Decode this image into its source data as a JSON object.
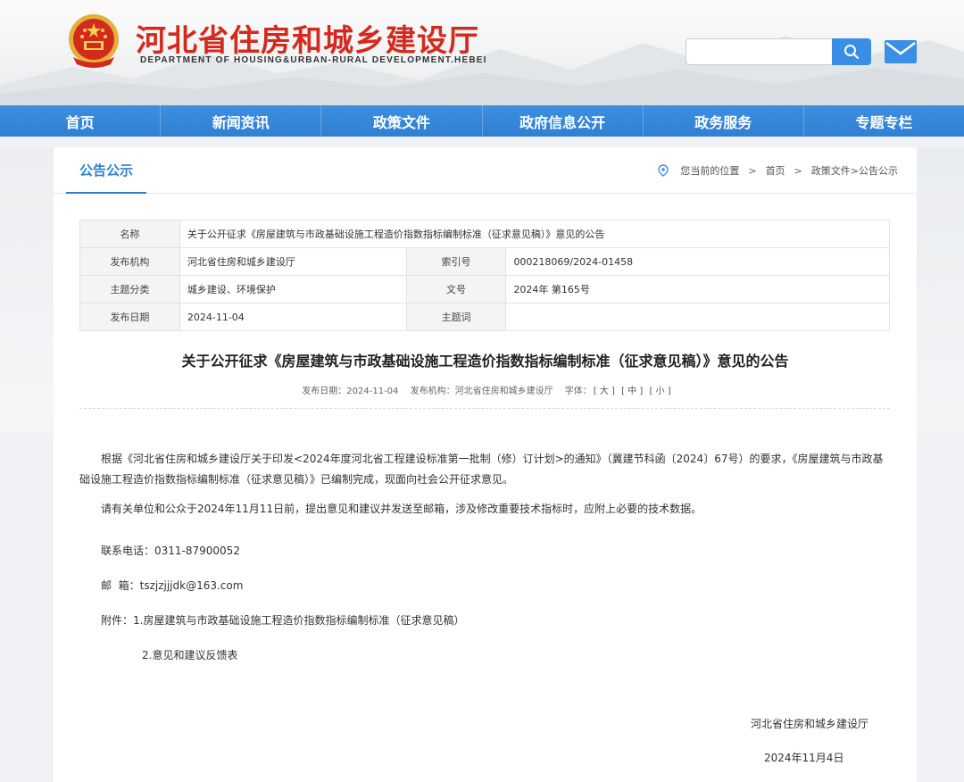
{
  "header": {
    "title": "河北省住房和城乡建设厅",
    "subtitle": "DEPARTMENT OF HOUSING&URBAN-RURAL DEVELOPMENT.HEBEI",
    "search_placeholder": ""
  },
  "nav": {
    "items": [
      "首页",
      "新闻资讯",
      "政策文件",
      "政府信息公开",
      "政务服务",
      "专题专栏"
    ]
  },
  "section": {
    "tab": "公告公示",
    "breadcrumb": {
      "prefix": "您当前的位置",
      "home": "首页",
      "path": "政策文件>公告公示"
    }
  },
  "info": {
    "name_label": "名称",
    "name_value": "关于公开征求《房屋建筑与市政基础设施工程造价指数指标编制标准（征求意见稿）》意见的公告",
    "org_label": "发布机构",
    "org_value": "河北省住房和城乡建设厅",
    "index_label": "索引号",
    "index_value": "000218069/2024-01458",
    "topic_label": "主题分类",
    "topic_value": "城乡建设、环境保护",
    "docno_label": "文号",
    "docno_value": "2024年 第165号",
    "date_label": "发布日期",
    "date_value": "2024-11-04",
    "keyword_label": "主题词",
    "keyword_value": ""
  },
  "article": {
    "title": "关于公开征求《房屋建筑与市政基础设施工程造价指数指标编制标准（征求意见稿）》意见的公告",
    "meta_date": "发布日期：2024-11-04",
    "meta_org": "发布机构：河北省住房和城乡建设厅",
    "meta_font": "字体：",
    "font_large": "[ 大 ]",
    "font_medium": "[ 中 ]",
    "font_small": "[ 小 ]",
    "p1": "根据《河北省住房和城乡建设厅关于印发<2024年度河北省工程建设标准第一批制（修）订计划>的通知》（冀建节科函〔2024〕67号）的要求，《房屋建筑与市政基础设施工程造价指数指标编制标准（征求意见稿）》已编制完成，现面向社会公开征求意见。",
    "p2": "请有关单位和公众于2024年11月11日前，提出意见和建议并发送至邮箱，涉及修改重要技术指标时，应附上必要的技术数据。",
    "phone": "联系电话：0311-87900052",
    "email": "邮  箱：tszjzjjjdk@163.com",
    "attachment1": "附件：1.房屋建筑与市政基础设施工程造价指数指标编制标准（征求意见稿）",
    "attachment2": "2.意见和建议反馈表",
    "sign_org": "河北省住房和城乡建设厅",
    "sign_date": "2024年11月4日"
  },
  "colors": {
    "brand_red": "#d42a1e",
    "nav_blue": "#2f7fd3",
    "accent_blue": "#3a8ee6"
  }
}
